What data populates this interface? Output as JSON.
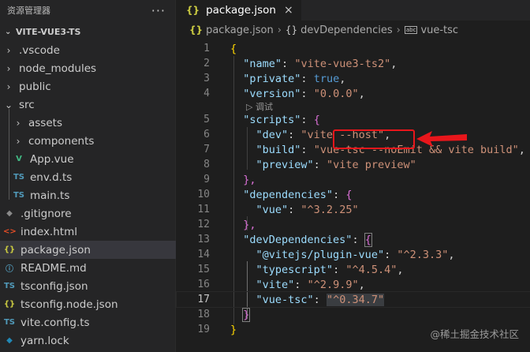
{
  "sidebar": {
    "title": "资源管理器",
    "more": "···",
    "project": "VITE-VUE3-TS",
    "items": [
      {
        "label": ".vscode",
        "chevron": "›",
        "icon": ""
      },
      {
        "label": "node_modules",
        "chevron": "›",
        "icon": ""
      },
      {
        "label": "public",
        "chevron": "›",
        "icon": ""
      },
      {
        "label": "src",
        "chevron": "⌄",
        "icon": ""
      },
      {
        "label": "assets",
        "chevron": "›",
        "icon": ""
      },
      {
        "label": "components",
        "chevron": "›",
        "icon": ""
      },
      {
        "label": "App.vue",
        "icon": "V"
      },
      {
        "label": "env.d.ts",
        "icon": "TS"
      },
      {
        "label": "main.ts",
        "icon": "TS"
      },
      {
        "label": ".gitignore",
        "icon": "◆"
      },
      {
        "label": "index.html",
        "icon": "<>"
      },
      {
        "label": "package.json",
        "icon": "{}"
      },
      {
        "label": "README.md",
        "icon": "ⓘ"
      },
      {
        "label": "tsconfig.json",
        "icon": "TS"
      },
      {
        "label": "tsconfig.node.json",
        "icon": "{}"
      },
      {
        "label": "vite.config.ts",
        "icon": "TS"
      },
      {
        "label": "yarn.lock",
        "icon": "◆"
      }
    ]
  },
  "tab": {
    "icon": "{}",
    "label": "package.json",
    "close": "×"
  },
  "breadcrumb": {
    "icon": "{}",
    "file": "package.json",
    "sep": "›",
    "braces": "{}",
    "section": "devDependencies",
    "abc": "abc",
    "leaf": "vue-tsc"
  },
  "codelens": "▷ 调试",
  "code": {
    "l1": "{",
    "l2_key": "\"name\"",
    "l2_val": "\"vite-vue3-ts2\"",
    "l3_key": "\"private\"",
    "l3_val": "true",
    "l4_key": "\"version\"",
    "l4_val": "\"0.0.0\"",
    "l5_key": "\"scripts\"",
    "l5_open": "{",
    "l6_key": "\"dev\"",
    "l6_val": "\"vite --host\"",
    "l7_key": "\"build\"",
    "l7_val": "\"vue-tsc --noEmit && vite build\"",
    "l8_key": "\"preview\"",
    "l8_val": "\"vite preview\"",
    "l9": "},",
    "l10_key": "\"dependencies\"",
    "l10_open": "{",
    "l11_key": "\"vue\"",
    "l11_val": "\"^3.2.25\"",
    "l12": "},",
    "l13_key": "\"devDependencies\"",
    "l13_open": "{",
    "l14_key": "\"@vitejs/plugin-vue\"",
    "l14_val": "\"^2.3.3\"",
    "l15_key": "\"typescript\"",
    "l15_val": "\"^4.5.4\"",
    "l16_key": "\"vite\"",
    "l16_val": "\"^2.9.9\"",
    "l17_key": "\"vue-tsc\"",
    "l17_val": "\"^0.34.7\"",
    "l18": "}",
    "l19": "}"
  },
  "line_numbers": [
    "1",
    "2",
    "3",
    "4",
    "5",
    "6",
    "7",
    "8",
    "9",
    "10",
    "11",
    "12",
    "13",
    "14",
    "15",
    "16",
    "17",
    "18",
    "19"
  ],
  "watermark": "@稀土掘金技术社区",
  "colors": {
    "annotation": "#e8161b",
    "accent": "#cbcb41"
  }
}
